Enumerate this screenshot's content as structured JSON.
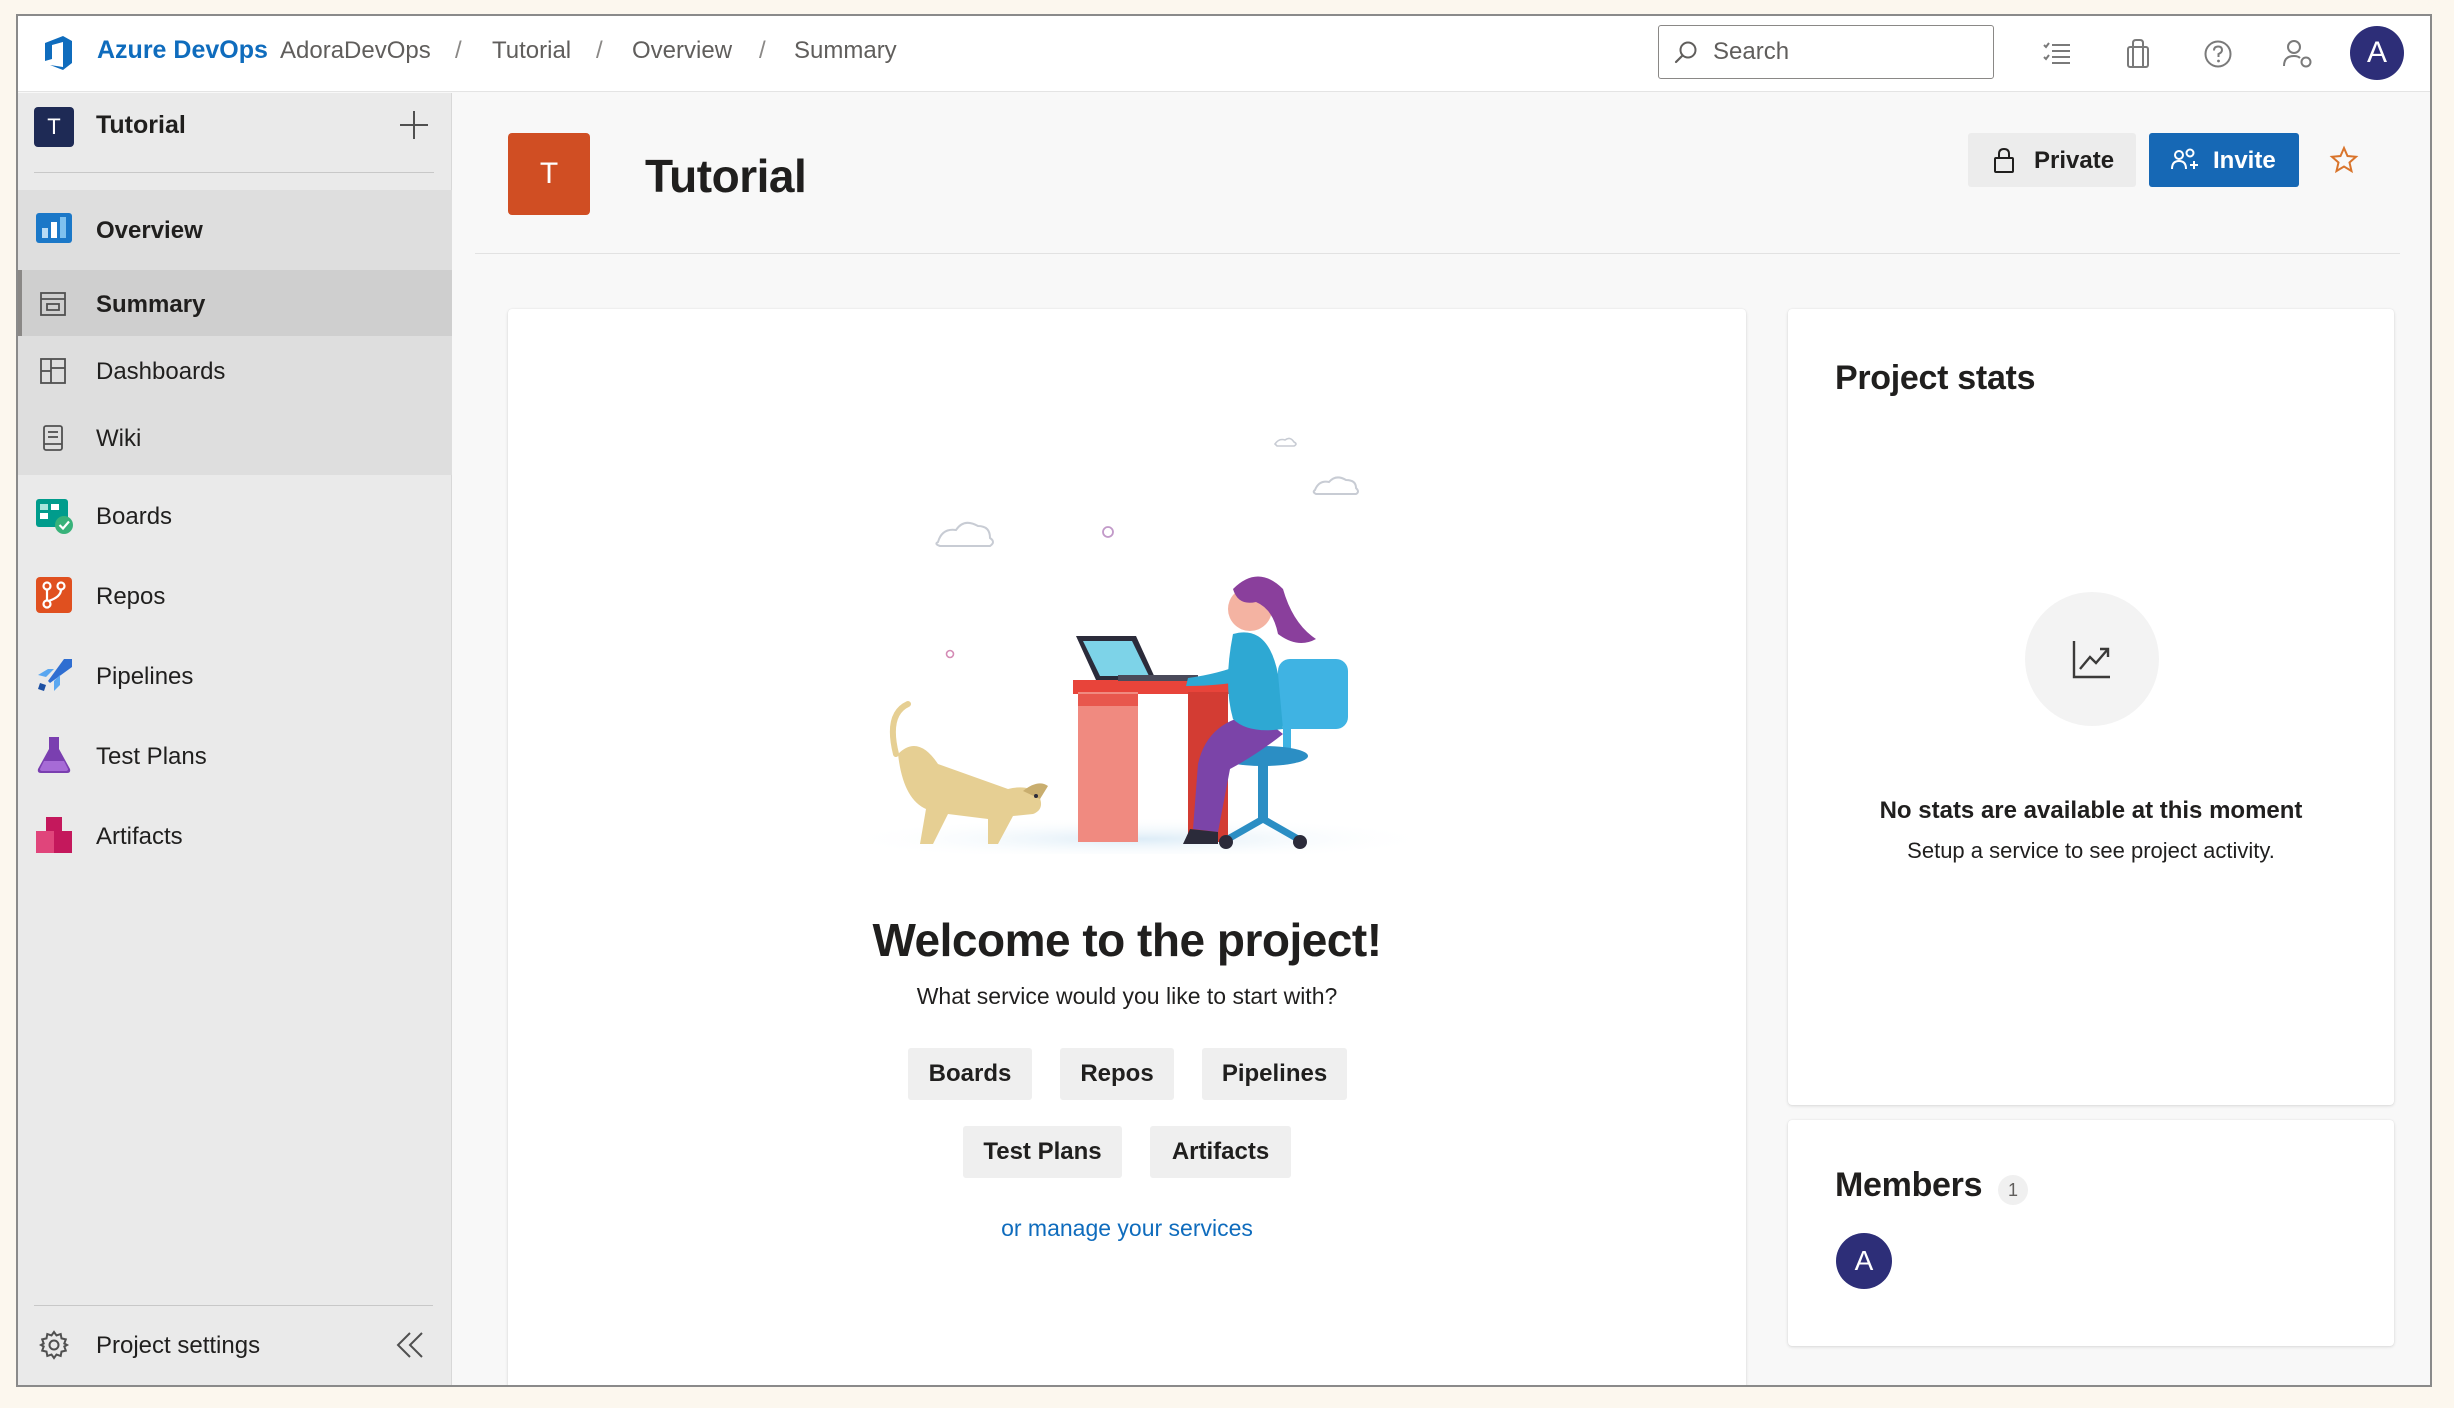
{
  "topbar": {
    "brand": "Azure DevOps",
    "breadcrumbs": [
      "AdoraDevOps",
      "Tutorial",
      "Overview",
      "Summary"
    ],
    "search_placeholder": "Search",
    "user_initial": "A"
  },
  "sidebar": {
    "project_initial": "T",
    "project_name": "Tutorial",
    "items": [
      {
        "label": "Overview",
        "icon": "overview-icon"
      },
      {
        "label": "Summary",
        "icon": "summary-icon"
      },
      {
        "label": "Dashboards",
        "icon": "dashboards-icon"
      },
      {
        "label": "Wiki",
        "icon": "wiki-icon"
      },
      {
        "label": "Boards",
        "icon": "boards-icon"
      },
      {
        "label": "Repos",
        "icon": "repos-icon"
      },
      {
        "label": "Pipelines",
        "icon": "pipelines-icon"
      },
      {
        "label": "Test Plans",
        "icon": "test-plans-icon"
      },
      {
        "label": "Artifacts",
        "icon": "artifacts-icon"
      }
    ],
    "settings_label": "Project settings"
  },
  "header": {
    "project_initial": "T",
    "title": "Tutorial",
    "private_label": "Private",
    "invite_label": "Invite"
  },
  "welcome": {
    "title": "Welcome to the project!",
    "subtitle": "What service would you like to start with?",
    "services": [
      "Boards",
      "Repos",
      "Pipelines",
      "Test Plans",
      "Artifacts"
    ],
    "manage_link": "or manage your services"
  },
  "stats": {
    "title": "Project stats",
    "empty_title": "No stats are available at this moment",
    "empty_subtitle": "Setup a service to see project activity."
  },
  "members": {
    "title": "Members",
    "count": "1",
    "avatar_initial": "A"
  },
  "colors": {
    "brand_blue": "#0f6cbd",
    "invite_button": "#1668b5",
    "project_badge": "#d04e23",
    "avatar": "#2d2e78"
  }
}
